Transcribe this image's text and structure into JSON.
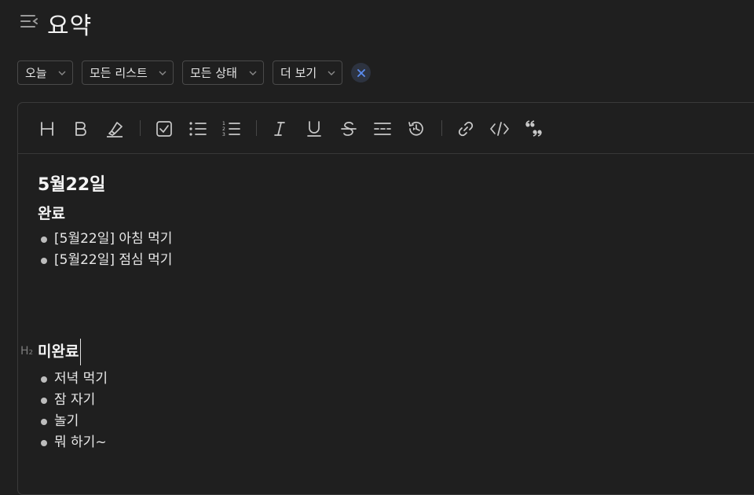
{
  "header": {
    "title": "요약",
    "menu_icon": "sidebar-toggle-icon"
  },
  "filters": [
    {
      "label": "오늘"
    },
    {
      "label": "모든 리스트"
    },
    {
      "label": "모든 상태"
    },
    {
      "label": "더 보기"
    }
  ],
  "clear_icon": "close-icon",
  "toolbar": [
    {
      "icon": "heading-icon"
    },
    {
      "icon": "bold-icon"
    },
    {
      "icon": "highlight-icon"
    },
    {
      "icon": "checkbox-icon"
    },
    {
      "icon": "bullet-list-icon"
    },
    {
      "icon": "numbered-list-icon"
    },
    {
      "icon": "italic-icon"
    },
    {
      "icon": "underline-icon"
    },
    {
      "icon": "strikethrough-icon"
    },
    {
      "icon": "divider-icon"
    },
    {
      "icon": "timestamp-icon"
    },
    {
      "icon": "link-icon"
    },
    {
      "icon": "code-icon"
    },
    {
      "icon": "quote-icon"
    }
  ],
  "doc": {
    "date_heading": "5월22일",
    "sections": [
      {
        "marker": "",
        "heading": "완료",
        "items": [
          "[5월22일] 아침 먹기",
          "[5월22일] 점심 먹기"
        ]
      },
      {
        "marker": "H₂",
        "heading": "미완료",
        "items": [
          "저녁 먹기",
          "잠 자기",
          "놀기",
          "뭐 하기~"
        ]
      }
    ]
  },
  "colors": {
    "background": "#1f1f1f",
    "text": "#ececec",
    "clear_accent": "#5b8cf0",
    "border": "#4a4a4a"
  }
}
